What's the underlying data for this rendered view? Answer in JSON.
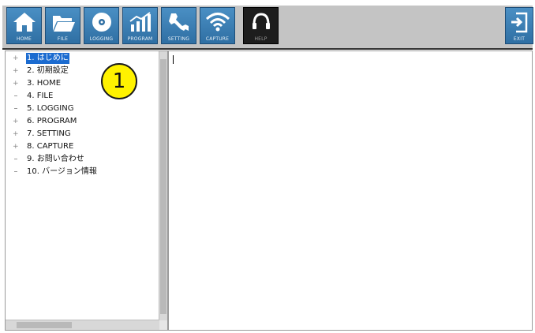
{
  "toolbar": {
    "buttons": [
      {
        "label": "HOME",
        "icon": "home-icon"
      },
      {
        "label": "FILE",
        "icon": "folder-icon"
      },
      {
        "label": "LOGGING",
        "icon": "disc-icon"
      },
      {
        "label": "PROGRAM",
        "icon": "chart-icon"
      },
      {
        "label": "SETTING",
        "icon": "wrench-icon"
      },
      {
        "label": "CAPTURE",
        "icon": "wifi-icon"
      },
      {
        "label": "HELP",
        "icon": "headset-icon",
        "active": true
      }
    ],
    "exit": {
      "label": "EXIT",
      "icon": "exit-icon"
    }
  },
  "tree": {
    "items": [
      {
        "label": "1. はじめに",
        "expandable": true,
        "selected": true
      },
      {
        "label": "2. 初期設定",
        "expandable": true
      },
      {
        "label": "3. HOME",
        "expandable": true
      },
      {
        "label": "4. FILE",
        "expandable": false
      },
      {
        "label": "5. LOGGING",
        "expandable": false
      },
      {
        "label": "6. PROGRAM",
        "expandable": true
      },
      {
        "label": "7. SETTING",
        "expandable": true
      },
      {
        "label": "8. CAPTURE",
        "expandable": true
      },
      {
        "label": "9. お問い合わせ",
        "expandable": false
      },
      {
        "label": "10. バージョン情報",
        "expandable": false
      }
    ]
  },
  "annotation": {
    "number": "1"
  },
  "colors": {
    "toolbar_button": "#2f6fa3",
    "selection": "#1b6bd0",
    "badge": "#fff200"
  }
}
